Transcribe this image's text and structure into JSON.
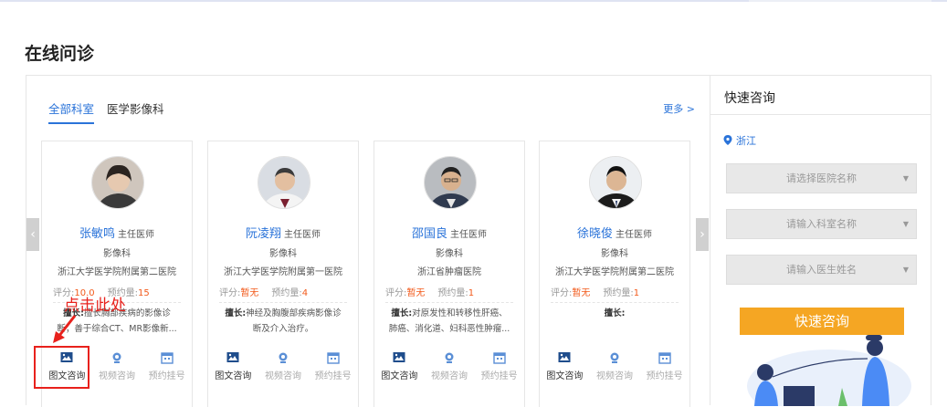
{
  "page": {
    "title": "在线问诊"
  },
  "tabs": [
    {
      "label": "全部科室",
      "active": true
    },
    {
      "label": "医学影像科",
      "active": false
    }
  ],
  "more_label": "更多 >",
  "rating_label": "评分:",
  "booking_label": "预约量:",
  "specialty_label": "擅长:",
  "services": [
    "图文咨询",
    "视频咨询",
    "预约挂号"
  ],
  "doctors": [
    {
      "name": "张敏鸣",
      "title": "主任医师",
      "dept": "影像科",
      "hospital": "浙江大学医学院附属第二医院",
      "rating": "10.0",
      "bookings": "15",
      "specialty_line1": "擅长胸部疾病的影像诊",
      "specialty_line2": "断；善于综合CT、MR影像新..."
    },
    {
      "name": "阮凌翔",
      "title": "主任医师",
      "dept": "影像科",
      "hospital": "浙江大学医学院附属第一医院",
      "rating": "暂无",
      "bookings": "4",
      "specialty_line1": "神经及胸腹部疾病影像诊",
      "specialty_line2": "断及介入治疗。"
    },
    {
      "name": "邵国良",
      "title": "主任医师",
      "dept": "影像科",
      "hospital": "浙江省肿瘤医院",
      "rating": "暂无",
      "bookings": "1",
      "specialty_line1": "对原发性和转移性肝癌、",
      "specialty_line2": "肺癌、消化道、妇科恶性肿瘤..."
    },
    {
      "name": "徐晓俊",
      "title": "主任医师",
      "dept": "影像科",
      "hospital": "浙江大学医学院附属第二医院",
      "rating": "暂无",
      "bookings": "1",
      "specialty_line1": "",
      "specialty_line2": ""
    }
  ],
  "annotation": {
    "text": "点击此处",
    "color": "#e8211c"
  },
  "side": {
    "title": "快速咨询",
    "location": "浙江",
    "hospital_placeholder": "请选择医院名称",
    "dept_placeholder": "请输入科室名称",
    "doctor_placeholder": "请输入医生姓名",
    "button_label": "快速咨询"
  },
  "colors": {
    "accent": "#2a73d9",
    "orange": "#f5a623",
    "highlight": "#f25a1b"
  }
}
